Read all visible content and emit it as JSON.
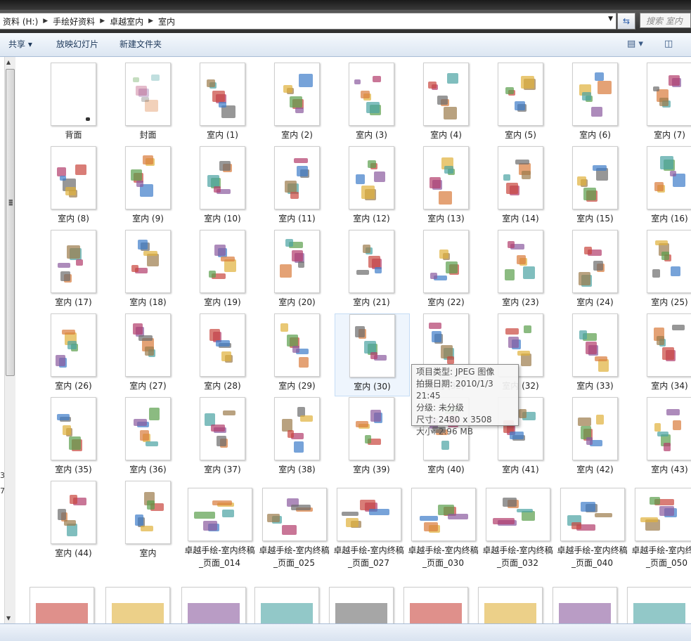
{
  "address": {
    "crumbs": [
      "资料 (H:)",
      "手绘好资料",
      "卓越室内",
      "室内"
    ],
    "search_placeholder": "搜索 室内"
  },
  "toolbar": {
    "share": "共享 ▾",
    "slideshow": "放映幻灯片",
    "new_folder": "新建文件夹"
  },
  "side_fragments": [
    "3",
    "7"
  ],
  "items": [
    "背面",
    "封面",
    "室内 (1)",
    "室内 (2)",
    "室内 (3)",
    "室内 (4)",
    "室内 (5)",
    "室内 (6)",
    "室内 (7)",
    "室内 (8)",
    "室内 (9)",
    "室内 (10)",
    "室内 (11)",
    "室内 (12)",
    "室内 (13)",
    "室内 (14)",
    "室内 (15)",
    "室内 (16)",
    "室内 (17)",
    "室内 (18)",
    "室内 (19)",
    "室内 (20)",
    "室内 (21)",
    "室内 (22)",
    "室内 (23)",
    "室内 (24)",
    "室内 (25)",
    "室内 (26)",
    "室内 (27)",
    "室内 (28)",
    "室内 (29)",
    "室内 (30)",
    "室内 (32)",
    "室内 (32)",
    "室内 (33)",
    "室内 (34)",
    "室内 (35)",
    "室内 (36)",
    "室内 (37)",
    "室内 (38)",
    "室内 (39)",
    "室内 (40)",
    "室内 (41)",
    "室内 (42)",
    "室内 (43)",
    "室内 (44)",
    "室内",
    "卓越手绘-室内终稿_页面_014",
    "卓越手绘-室内终稿_页面_025",
    "卓越手绘-室内终稿_页面_027",
    "卓越手绘-室内终稿_页面_030",
    "卓越手绘-室内终稿_页面_032",
    "卓越手绘-室内终稿_页面_040",
    "卓越手绘-室内终稿_页面_050"
  ],
  "selected_index": 31,
  "tooltip": {
    "type": "项目类型: JPEG 图像",
    "date": "拍摄日期: 2010/1/3 21:45",
    "rating": "分级: 未分级",
    "size_px": "尺寸: 2480 x 3508",
    "size": "大小: 2.96 MB"
  },
  "colors": {
    "toolbar_text": "#1e395b",
    "selection": "#eef5fd"
  }
}
